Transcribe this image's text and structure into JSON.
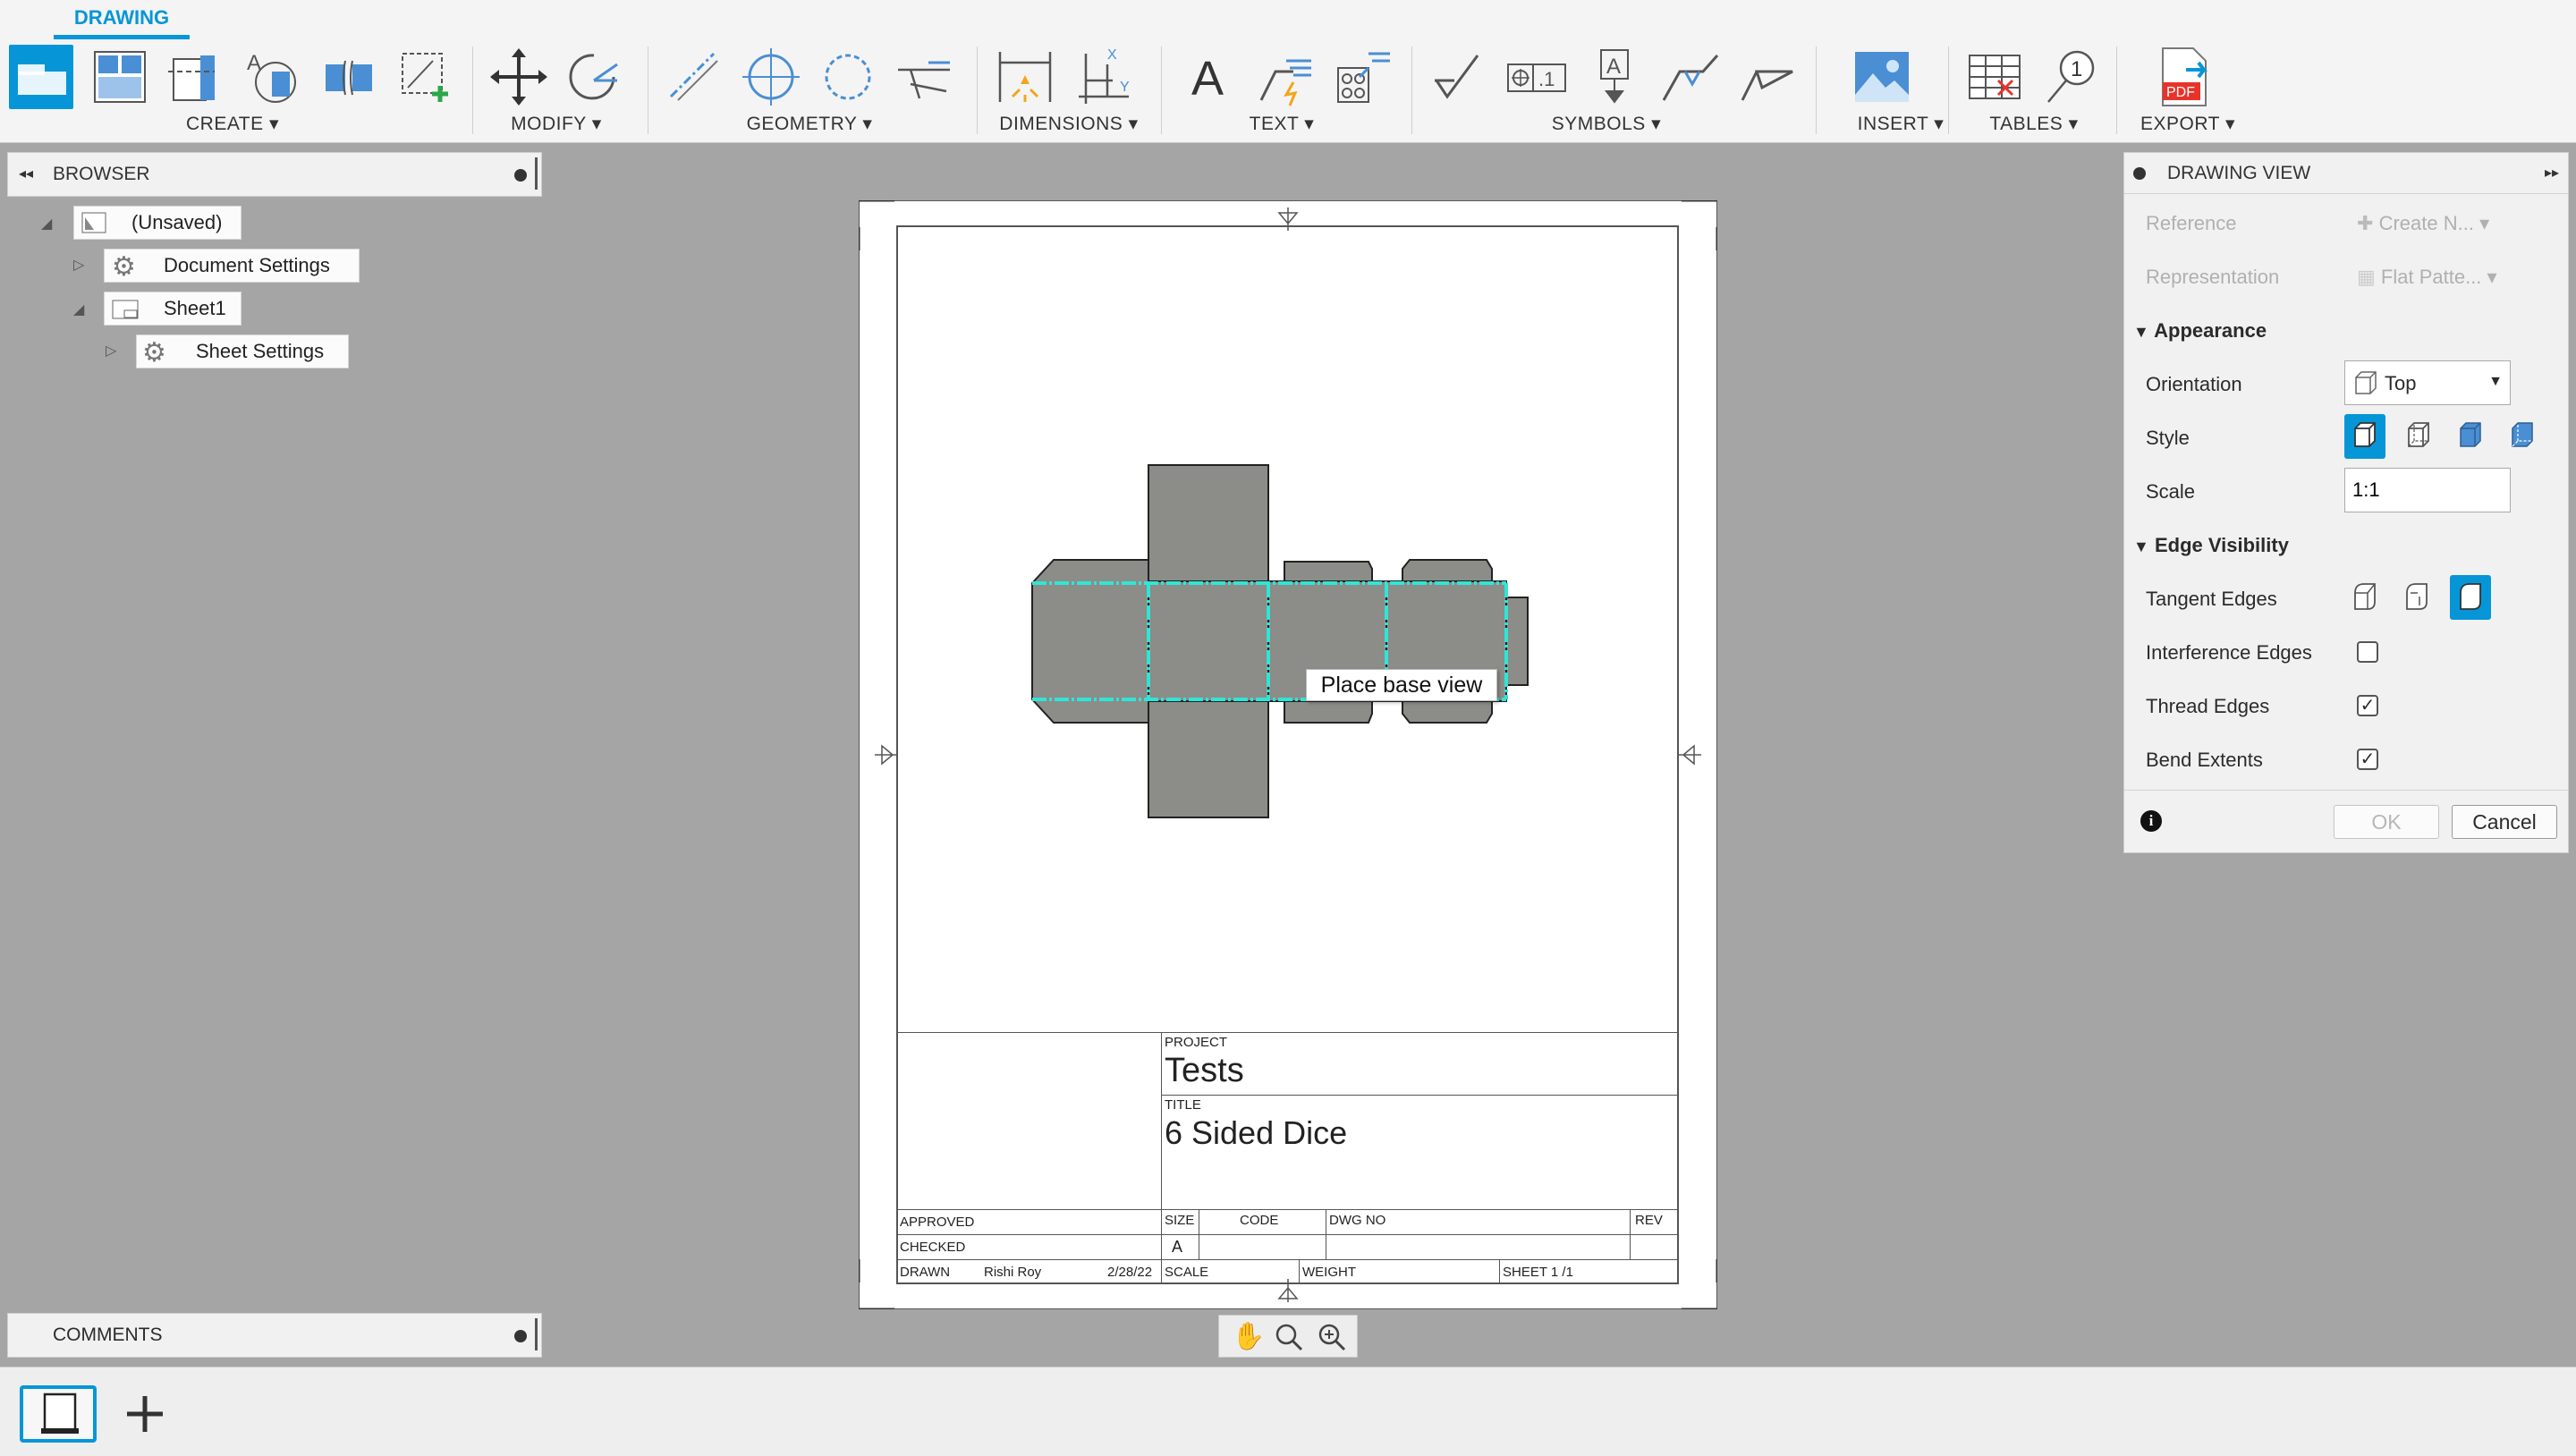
{
  "ribbon": {
    "active_tab": "DRAWING",
    "groups": {
      "create": "CREATE",
      "modify": "MODIFY",
      "geometry": "GEOMETRY",
      "dimensions": "DIMENSIONS",
      "text": "TEXT",
      "symbols": "SYMBOLS",
      "insert": "INSERT",
      "tables": "TABLES",
      "export": "EXPORT"
    },
    "caret": "▾",
    "export_icon_text": "PDF",
    "text_icon_glyph": "A",
    "balloon_glyph": "1"
  },
  "browser": {
    "title": "BROWSER",
    "items": {
      "root": "(Unsaved)",
      "document_settings": "Document Settings",
      "sheet1": "Sheet1",
      "sheet_settings": "Sheet Settings"
    }
  },
  "comments": {
    "title": "COMMENTS"
  },
  "canvas": {
    "tooltip": "Place base view"
  },
  "title_block": {
    "project_label": "PROJECT",
    "project_value": "Tests",
    "title_label": "TITLE",
    "title_value": "6 Sided Dice",
    "approved_label": "APPROVED",
    "checked_label": "CHECKED",
    "drawn_label": "DRAWN",
    "drawn_by": "Rishi Roy",
    "drawn_date": "2/28/22",
    "size_label": "SIZE",
    "size_value": "A",
    "code_label": "CODE",
    "dwgno_label": "DWG NO",
    "rev_label": "REV",
    "scale_label": "SCALE",
    "weight_label": "WEIGHT",
    "sheet_label": "SHEET 1 /1"
  },
  "drawing_view": {
    "title": "DRAWING VIEW",
    "reference_label": "Reference",
    "reference_value": "Create N...",
    "representation_label": "Representation",
    "representation_value": "Flat Patte...",
    "appearance_section": "Appearance",
    "orientation_label": "Orientation",
    "orientation_value": "Top",
    "style_label": "Style",
    "scale_label": "Scale",
    "scale_value": "1:1",
    "edge_section": "Edge Visibility",
    "tangent_label": "Tangent Edges",
    "interference_label": "Interference Edges",
    "interference_checked": false,
    "thread_label": "Thread Edges",
    "thread_checked": true,
    "bend_label": "Bend Extents",
    "bend_checked": true,
    "ok_label": "OK",
    "cancel_label": "Cancel",
    "check_glyph": "✓"
  },
  "colors": {
    "accent": "#0696d7",
    "bend_line": "#2ee6d6",
    "part_fill": "#8c8c88",
    "insert_green": "#2aa84a",
    "pdf_red": "#e8332a"
  }
}
